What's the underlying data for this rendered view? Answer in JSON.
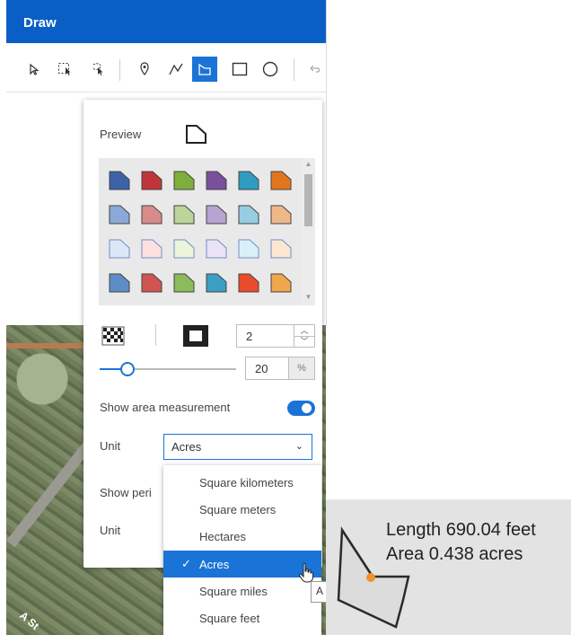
{
  "header": {
    "title": "Draw"
  },
  "toolbar": {
    "tools": [
      "select-arrow-icon",
      "rectangle-select-icon",
      "lasso-select-icon",
      "point-icon",
      "polyline-icon",
      "polygon-icon",
      "rectangle-icon",
      "circle-icon",
      "undo-icon"
    ],
    "active_tool": "polygon-icon"
  },
  "style_panel": {
    "preview_label": "Preview",
    "swatch_colors": [
      [
        "#3d62a8",
        "#c0353a",
        "#7fae3e",
        "#7a4f9b",
        "#2f9cc2",
        "#e3761c"
      ],
      [
        "#8aa9d8",
        "#d98b8c",
        "#b9d59a",
        "#b9a3d1",
        "#96cde0",
        "#efb88b"
      ],
      [
        "#dbe7f8",
        "#fde0e0",
        "#ecf5d9",
        "#ece2f5",
        "#d9f0f8",
        "#fde6cf"
      ],
      [
        "#5d8dc7",
        "#d15454",
        "#8dbb5b",
        "#3b9fc4",
        "#ea4b2a",
        "#f0a64a"
      ]
    ],
    "outline_width": "2",
    "opacity_value": "20",
    "opacity_unit": "%",
    "opacity_fraction": 0.2,
    "show_area_label": "Show area measurement",
    "show_area_on": true,
    "unit_label": "Unit",
    "area_unit_selected": "Acres",
    "show_perimeter_label": "Show peri",
    "unit_label_2": "Unit"
  },
  "area_unit_dropdown": {
    "options": [
      "Square kilometers",
      "Square meters",
      "Hectares",
      "Acres",
      "Square miles",
      "Square feet"
    ],
    "selected_index": 3,
    "check": "✓"
  },
  "tooltip": {
    "text": "A"
  },
  "map": {
    "street_label": "A St"
  },
  "callout": {
    "length_text": "Length 690.04 feet",
    "area_text": "Area 0.438 acres"
  }
}
